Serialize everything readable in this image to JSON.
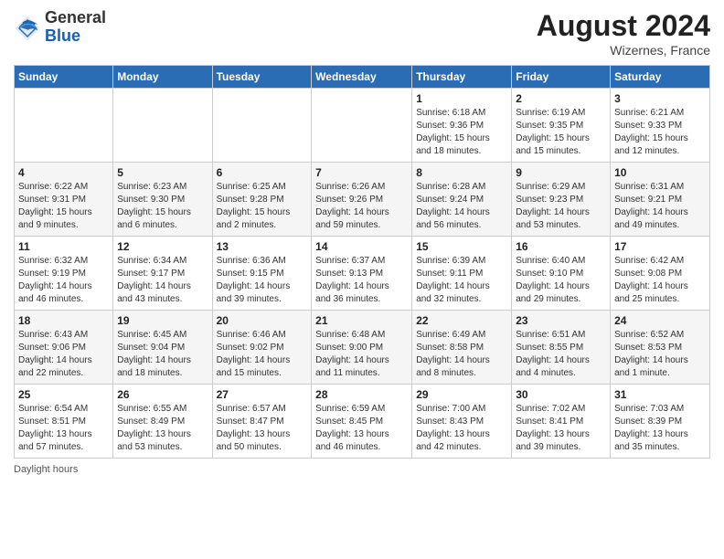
{
  "header": {
    "logo_general": "General",
    "logo_blue": "Blue",
    "month_year": "August 2024",
    "location": "Wizernes, France"
  },
  "footer": {
    "daylight_note": "Daylight hours"
  },
  "days_of_week": [
    "Sunday",
    "Monday",
    "Tuesday",
    "Wednesday",
    "Thursday",
    "Friday",
    "Saturday"
  ],
  "weeks": [
    [
      {
        "day": "",
        "info": ""
      },
      {
        "day": "",
        "info": ""
      },
      {
        "day": "",
        "info": ""
      },
      {
        "day": "",
        "info": ""
      },
      {
        "day": "1",
        "info": "Sunrise: 6:18 AM\nSunset: 9:36 PM\nDaylight: 15 hours\nand 18 minutes."
      },
      {
        "day": "2",
        "info": "Sunrise: 6:19 AM\nSunset: 9:35 PM\nDaylight: 15 hours\nand 15 minutes."
      },
      {
        "day": "3",
        "info": "Sunrise: 6:21 AM\nSunset: 9:33 PM\nDaylight: 15 hours\nand 12 minutes."
      }
    ],
    [
      {
        "day": "4",
        "info": "Sunrise: 6:22 AM\nSunset: 9:31 PM\nDaylight: 15 hours\nand 9 minutes."
      },
      {
        "day": "5",
        "info": "Sunrise: 6:23 AM\nSunset: 9:30 PM\nDaylight: 15 hours\nand 6 minutes."
      },
      {
        "day": "6",
        "info": "Sunrise: 6:25 AM\nSunset: 9:28 PM\nDaylight: 15 hours\nand 2 minutes."
      },
      {
        "day": "7",
        "info": "Sunrise: 6:26 AM\nSunset: 9:26 PM\nDaylight: 14 hours\nand 59 minutes."
      },
      {
        "day": "8",
        "info": "Sunrise: 6:28 AM\nSunset: 9:24 PM\nDaylight: 14 hours\nand 56 minutes."
      },
      {
        "day": "9",
        "info": "Sunrise: 6:29 AM\nSunset: 9:23 PM\nDaylight: 14 hours\nand 53 minutes."
      },
      {
        "day": "10",
        "info": "Sunrise: 6:31 AM\nSunset: 9:21 PM\nDaylight: 14 hours\nand 49 minutes."
      }
    ],
    [
      {
        "day": "11",
        "info": "Sunrise: 6:32 AM\nSunset: 9:19 PM\nDaylight: 14 hours\nand 46 minutes."
      },
      {
        "day": "12",
        "info": "Sunrise: 6:34 AM\nSunset: 9:17 PM\nDaylight: 14 hours\nand 43 minutes."
      },
      {
        "day": "13",
        "info": "Sunrise: 6:36 AM\nSunset: 9:15 PM\nDaylight: 14 hours\nand 39 minutes."
      },
      {
        "day": "14",
        "info": "Sunrise: 6:37 AM\nSunset: 9:13 PM\nDaylight: 14 hours\nand 36 minutes."
      },
      {
        "day": "15",
        "info": "Sunrise: 6:39 AM\nSunset: 9:11 PM\nDaylight: 14 hours\nand 32 minutes."
      },
      {
        "day": "16",
        "info": "Sunrise: 6:40 AM\nSunset: 9:10 PM\nDaylight: 14 hours\nand 29 minutes."
      },
      {
        "day": "17",
        "info": "Sunrise: 6:42 AM\nSunset: 9:08 PM\nDaylight: 14 hours\nand 25 minutes."
      }
    ],
    [
      {
        "day": "18",
        "info": "Sunrise: 6:43 AM\nSunset: 9:06 PM\nDaylight: 14 hours\nand 22 minutes."
      },
      {
        "day": "19",
        "info": "Sunrise: 6:45 AM\nSunset: 9:04 PM\nDaylight: 14 hours\nand 18 minutes."
      },
      {
        "day": "20",
        "info": "Sunrise: 6:46 AM\nSunset: 9:02 PM\nDaylight: 14 hours\nand 15 minutes."
      },
      {
        "day": "21",
        "info": "Sunrise: 6:48 AM\nSunset: 9:00 PM\nDaylight: 14 hours\nand 11 minutes."
      },
      {
        "day": "22",
        "info": "Sunrise: 6:49 AM\nSunset: 8:58 PM\nDaylight: 14 hours\nand 8 minutes."
      },
      {
        "day": "23",
        "info": "Sunrise: 6:51 AM\nSunset: 8:55 PM\nDaylight: 14 hours\nand 4 minutes."
      },
      {
        "day": "24",
        "info": "Sunrise: 6:52 AM\nSunset: 8:53 PM\nDaylight: 14 hours\nand 1 minute."
      }
    ],
    [
      {
        "day": "25",
        "info": "Sunrise: 6:54 AM\nSunset: 8:51 PM\nDaylight: 13 hours\nand 57 minutes."
      },
      {
        "day": "26",
        "info": "Sunrise: 6:55 AM\nSunset: 8:49 PM\nDaylight: 13 hours\nand 53 minutes."
      },
      {
        "day": "27",
        "info": "Sunrise: 6:57 AM\nSunset: 8:47 PM\nDaylight: 13 hours\nand 50 minutes."
      },
      {
        "day": "28",
        "info": "Sunrise: 6:59 AM\nSunset: 8:45 PM\nDaylight: 13 hours\nand 46 minutes."
      },
      {
        "day": "29",
        "info": "Sunrise: 7:00 AM\nSunset: 8:43 PM\nDaylight: 13 hours\nand 42 minutes."
      },
      {
        "day": "30",
        "info": "Sunrise: 7:02 AM\nSunset: 8:41 PM\nDaylight: 13 hours\nand 39 minutes."
      },
      {
        "day": "31",
        "info": "Sunrise: 7:03 AM\nSunset: 8:39 PM\nDaylight: 13 hours\nand 35 minutes."
      }
    ]
  ]
}
